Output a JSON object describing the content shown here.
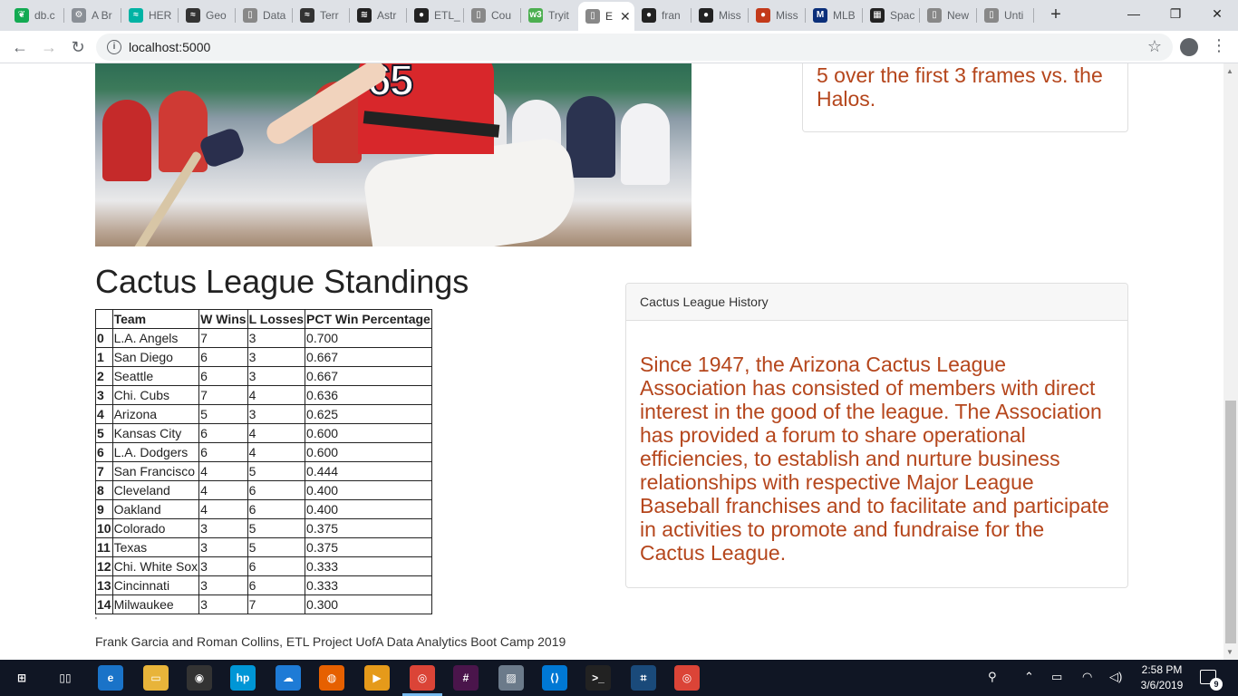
{
  "browser": {
    "tabs": [
      {
        "label": "db.c",
        "icon": "leaf-icon",
        "color": "#13aa52"
      },
      {
        "label": "A Br",
        "icon": "gear-icon",
        "color": "#8a8f96"
      },
      {
        "label": "HER",
        "icon": "wave-icon",
        "color": "#00b3a4"
      },
      {
        "label": "Geo",
        "icon": "wave-icon",
        "color": "#333333"
      },
      {
        "label": "Data",
        "icon": "document-icon",
        "color": "#888888"
      },
      {
        "label": "Terr",
        "icon": "wave-icon",
        "color": "#333333"
      },
      {
        "label": "Astr",
        "icon": "zigzag-icon",
        "color": "#222222"
      },
      {
        "label": "ETL_",
        "icon": "github-icon",
        "color": "#222222"
      },
      {
        "label": "Cou",
        "icon": "document-icon",
        "color": "#888888"
      },
      {
        "label": "Tryit",
        "icon": "w3-icon",
        "color": "#4caf50"
      },
      {
        "label": "E",
        "icon": "document-icon",
        "color": "#888888",
        "active": true
      },
      {
        "label": "fran",
        "icon": "github-icon",
        "color": "#222222"
      },
      {
        "label": "Miss",
        "icon": "github-icon",
        "color": "#222222"
      },
      {
        "label": "Miss",
        "icon": "globe-icon",
        "color": "#c33a1a"
      },
      {
        "label": "MLB",
        "icon": "mlb-icon",
        "color": "#0b2f7a"
      },
      {
        "label": "Spac",
        "icon": "checker-icon",
        "color": "#222222"
      },
      {
        "label": "New",
        "icon": "document-icon",
        "color": "#888888"
      },
      {
        "label": "Unti",
        "icon": "document-icon",
        "color": "#888888"
      }
    ],
    "new_tab": "+",
    "window_controls": {
      "minimize": "—",
      "restore": "❐",
      "close": "✕"
    },
    "url": "localhost:5000"
  },
  "page": {
    "top_card_text": "5 over the first 3 frames vs. the Halos.",
    "standings_title": "Cactus League Standings",
    "table": {
      "headers": [
        "",
        "Team",
        "W Wins",
        "L Losses",
        "PCT Win Percentage"
      ],
      "rows": [
        [
          "0",
          "L.A. Angels",
          "7",
          "3",
          "0.700"
        ],
        [
          "1",
          "San Diego",
          "6",
          "3",
          "0.667"
        ],
        [
          "2",
          "Seattle",
          "6",
          "3",
          "0.667"
        ],
        [
          "3",
          "Chi. Cubs",
          "7",
          "4",
          "0.636"
        ],
        [
          "4",
          "Arizona",
          "5",
          "3",
          "0.625"
        ],
        [
          "5",
          "Kansas City",
          "6",
          "4",
          "0.600"
        ],
        [
          "6",
          "L.A. Dodgers",
          "6",
          "4",
          "0.600"
        ],
        [
          "7",
          "San Francisco",
          "4",
          "5",
          "0.444"
        ],
        [
          "8",
          "Cleveland",
          "4",
          "6",
          "0.400"
        ],
        [
          "9",
          "Oakland",
          "4",
          "6",
          "0.400"
        ],
        [
          "10",
          "Colorado",
          "3",
          "5",
          "0.375"
        ],
        [
          "11",
          "Texas",
          "3",
          "5",
          "0.375"
        ],
        [
          "12",
          "Chi. White Sox",
          "3",
          "6",
          "0.333"
        ],
        [
          "13",
          "Cincinnati",
          "3",
          "6",
          "0.333"
        ],
        [
          "14",
          "Milwaukee",
          "3",
          "7",
          "0.300"
        ]
      ]
    },
    "history_card": {
      "header": "Cactus League History",
      "body": "Since 1947, the Arizona Cactus League Association has consisted of members with direct interest in the good of the league. The Association has provided a forum to share operational efficiencies, to establish and nurture business relationships with respective Major League Baseball franchises and to facilitate and participate in activities to promote and fundraise for the Cactus League."
    },
    "footer_mark": "'",
    "footer": "Frank Garcia and Roman Collins, ETL Project UofA Data Analytics Boot Camp 2019",
    "accent_color": "#b5461c"
  },
  "taskbar": {
    "apps": [
      "windows-start-icon",
      "task-view-icon",
      "edge-icon",
      "file-explorer-icon",
      "webcam-icon",
      "hp-icon",
      "onedrive-icon",
      "firefox-icon",
      "media-player-icon",
      "chrome-icon",
      "slack-icon",
      "image-viewer-icon",
      "vscode-icon",
      "terminal-icon",
      "sql-tool-icon",
      "chrome-icon"
    ],
    "time": "2:58 PM",
    "date": "3/6/2019",
    "notification_count": "9"
  }
}
